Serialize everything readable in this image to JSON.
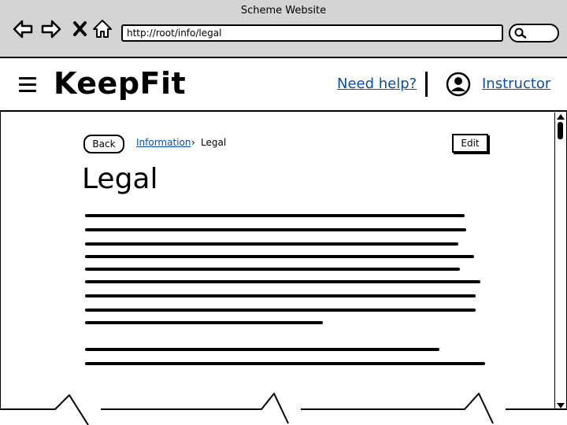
{
  "window": {
    "title": "Scheme Website"
  },
  "toolbar": {
    "url": "http://root/info/legal"
  },
  "header": {
    "brand": "KeepFit",
    "help_link": "Need help?",
    "user_link": "Instructor"
  },
  "page": {
    "back_label": "Back",
    "breadcrumb": {
      "parent": "Information",
      "separator": "›",
      "current": "Legal"
    },
    "edit_label": "Edit",
    "title": "Legal"
  },
  "icons": [
    "back-arrow-icon",
    "forward-arrow-icon",
    "close-icon",
    "home-icon",
    "search-icon",
    "menu-icon",
    "user-avatar-icon"
  ]
}
